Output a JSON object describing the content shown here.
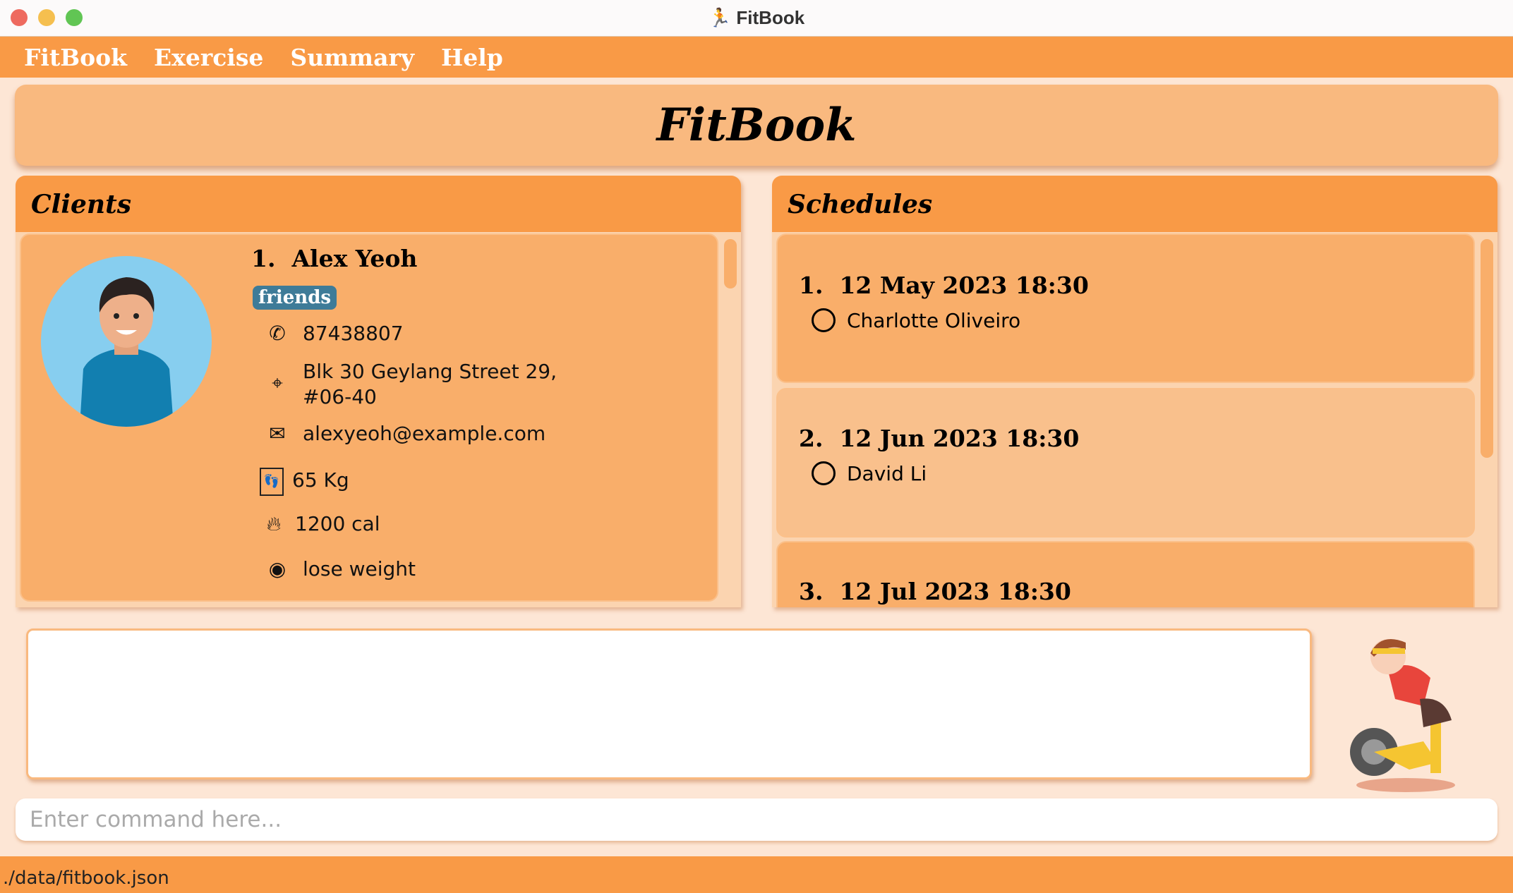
{
  "window": {
    "title": "FitBook",
    "app_icon": "running-person-icon"
  },
  "menu": [
    "FitBook",
    "Exercise",
    "Summary",
    "Help"
  ],
  "header": {
    "title": "FitBook"
  },
  "clients": {
    "title": "Clients",
    "items": [
      {
        "index": "1.",
        "name": "Alex Yeoh",
        "tag": "friends",
        "phone": "87438807",
        "address_line1": "Blk 30 Geylang Street 29,",
        "address_line2": "#06-40",
        "email": "alexyeoh@example.com",
        "weight": "65 Kg",
        "calories": "1200 cal",
        "goal": "lose weight"
      }
    ]
  },
  "schedules": {
    "title": "Schedules",
    "items": [
      {
        "index": "1.",
        "date": "12 May 2023 18:30",
        "client": "Charlotte Oliveiro"
      },
      {
        "index": "2.",
        "date": "12 Jun 2023 18:30",
        "client": "David Li"
      },
      {
        "index": "3.",
        "date": "12 Jul 2023 18:30",
        "client": ""
      }
    ]
  },
  "command": {
    "placeholder": "Enter command here...",
    "value": ""
  },
  "status": {
    "path": "./data/fitbook.json"
  },
  "colors": {
    "primary": "#f99a46",
    "card": "#f9ae6a",
    "header": "#f9b97f",
    "background": "#fde6d5",
    "tag": "#3e7b98"
  }
}
